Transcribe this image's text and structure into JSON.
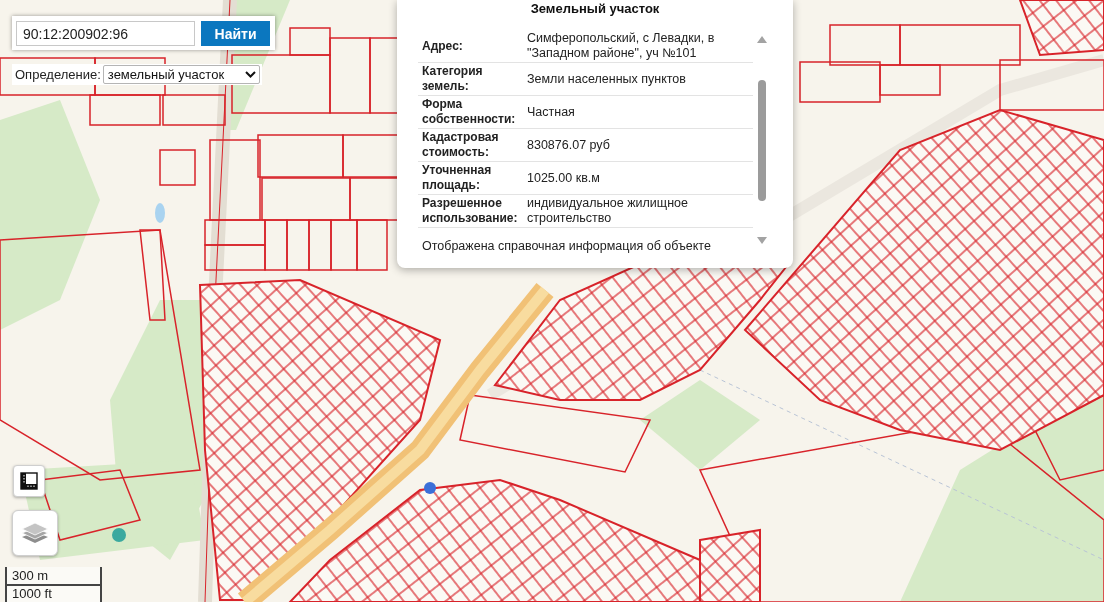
{
  "search": {
    "value": "90:12:200902:96",
    "button": "Найти"
  },
  "mode": {
    "label": "Определение:",
    "value": "земельный участок"
  },
  "popup": {
    "title": "Земельный участок",
    "rows": [
      {
        "label": "Адрес:",
        "value": "Симферопольский, с Левадки, в \"Западном районе\", уч №101"
      },
      {
        "label": "Категория земель:",
        "value": "Земли населенных пунктов"
      },
      {
        "label": "Форма собственности:",
        "value": "Частная"
      },
      {
        "label": "Кадастровая стоимость:",
        "value": "830876.07 руб"
      },
      {
        "label": "Уточненная площадь:",
        "value": "1025.00 кв.м"
      },
      {
        "label": "Разрешенное использование:",
        "value": "индивидуальное жилищное строительство"
      }
    ],
    "footer": "Отображена справочная информация об объекте"
  },
  "scale": {
    "metric": "300 m",
    "imperial": "1000 ft"
  }
}
